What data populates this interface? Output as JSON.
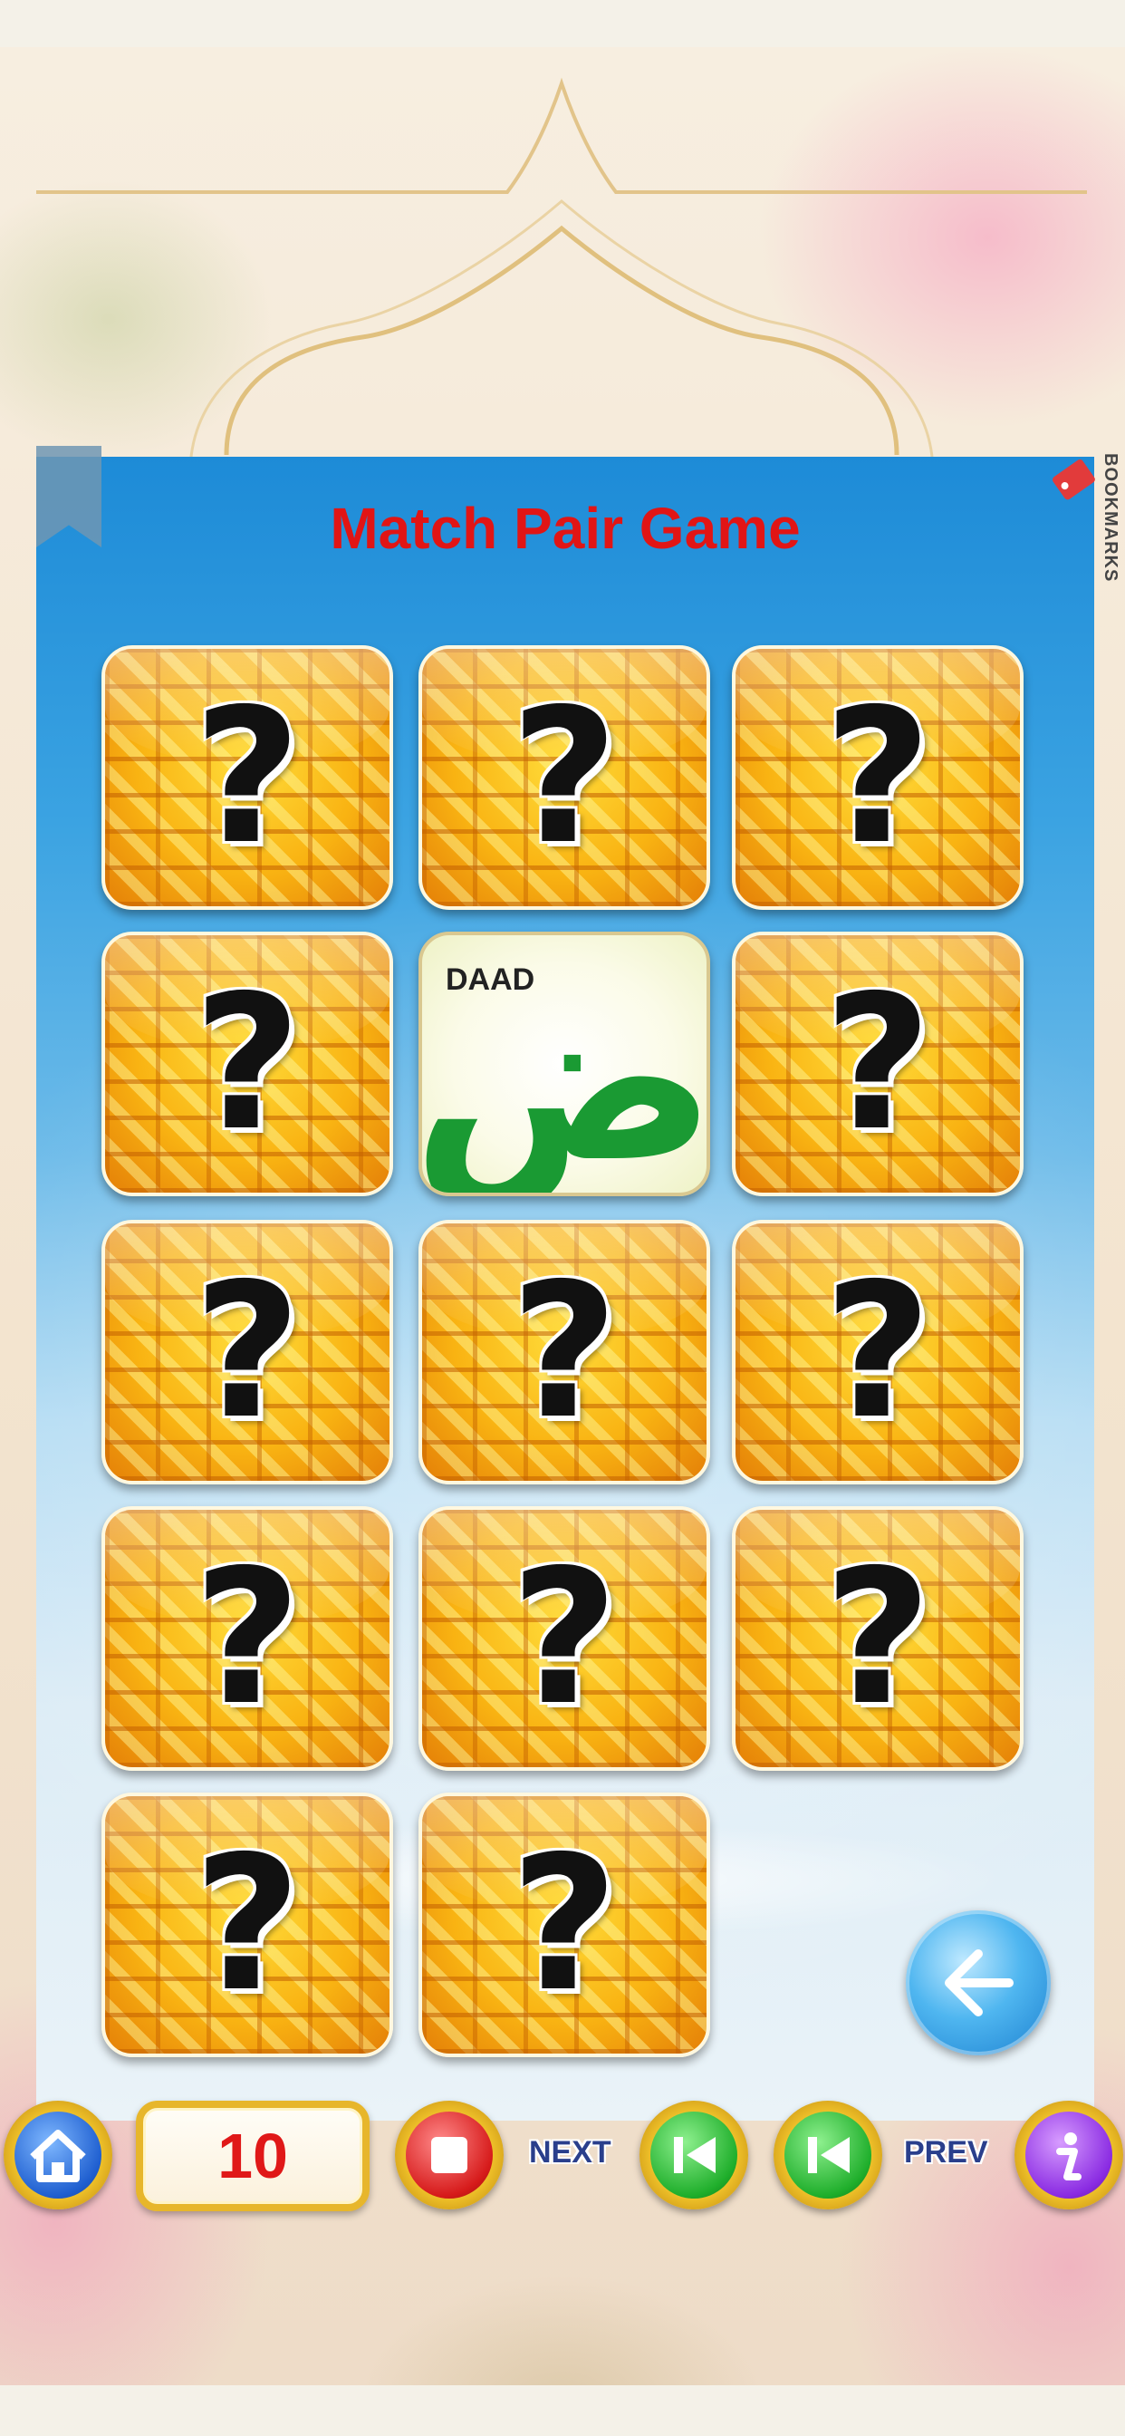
{
  "game": {
    "title": "Match Pair Game",
    "bookmarks_label": "BOOKMARKS"
  },
  "tiles": [
    {
      "state": "hidden",
      "symbol": "?"
    },
    {
      "state": "hidden",
      "symbol": "?"
    },
    {
      "state": "hidden",
      "symbol": "?"
    },
    {
      "state": "hidden",
      "symbol": "?"
    },
    {
      "state": "revealed",
      "name": "DAAD",
      "letter": "ض"
    },
    {
      "state": "hidden",
      "symbol": "?"
    },
    {
      "state": "hidden",
      "symbol": "?"
    },
    {
      "state": "hidden",
      "symbol": "?"
    },
    {
      "state": "hidden",
      "symbol": "?"
    },
    {
      "state": "hidden",
      "symbol": "?"
    },
    {
      "state": "hidden",
      "symbol": "?"
    },
    {
      "state": "hidden",
      "symbol": "?"
    },
    {
      "state": "hidden",
      "symbol": "?"
    },
    {
      "state": "hidden",
      "symbol": "?"
    }
  ],
  "toolbar": {
    "page_number": "10",
    "next_label": "NEXT",
    "prev_label": "PREV",
    "icons": [
      "home-icon",
      "stop-icon",
      "skip-back-icon",
      "skip-back-icon",
      "info-icon",
      "arrow-left-icon"
    ]
  },
  "colors": {
    "title": "#e11515",
    "letter": "#1a9a33",
    "counter_text": "#e01818",
    "nav_label": "#2a3f8c"
  }
}
